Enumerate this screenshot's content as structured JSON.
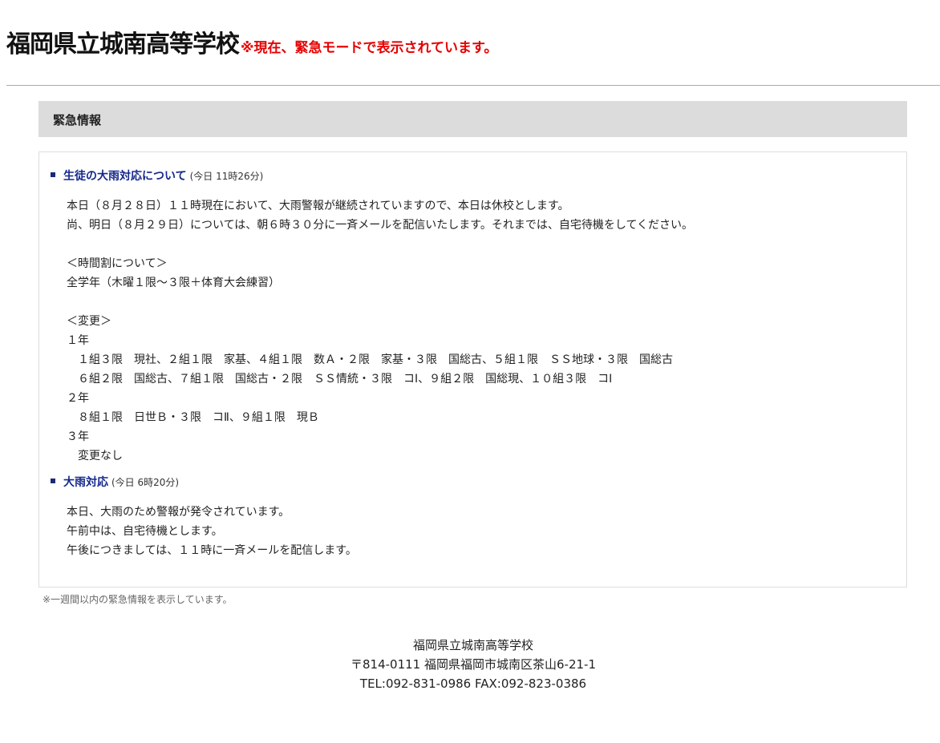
{
  "header": {
    "site_title": "福岡県立城南高等学校",
    "mode_note": "※現在、緊急モードで表示されています。"
  },
  "section": {
    "heading": "緊急情報"
  },
  "items": [
    {
      "title": "生徒の大雨対応について",
      "time": "(今日 11時26分)",
      "body": "本日（８月２８日）１１時現在において、大雨警報が継続されていますので、本日は休校とします。\n尚、明日（８月２９日）については、朝６時３０分に一斉メールを配信いたします。それまでは、自宅待機をしてください。\n\n＜時間割について＞\n全学年（木曜１限～３限＋体育大会練習）\n\n＜変更＞\n１年\n　１組３限　現社、２組１限　家基、４組１限　数Ａ・２限　家基・３限　国総古、５組１限　ＳＳ地球・３限　国総古\n　６組２限　国総古、７組１限　国総古・２限　ＳＳ情統・３限　コⅠ、９組２限　国総現、１０組３限　コⅠ\n２年\n　８組１限　日世Ｂ・３限　コⅡ、９組１限　現Ｂ\n３年\n　変更なし"
    },
    {
      "title": "大雨対応",
      "time": "(今日 6時20分)",
      "body": "本日、大雨のため警報が発令されています。\n午前中は、自宅待機とします。\n午後につきましては、１１時に一斉メールを配信します。"
    }
  ],
  "footnote": "※一週間以内の緊急情報を表示しています。",
  "footer": {
    "school_name": "福岡県立城南高等学校",
    "address": "〒814-0111 福岡県福岡市城南区茶山6-21-1",
    "contact": "TEL:092-831-0986 FAX:092-823-0386"
  },
  "colors": {
    "mode_note": "#e60000",
    "item_title": "#14288c",
    "section_bg": "#dcdcdc"
  }
}
